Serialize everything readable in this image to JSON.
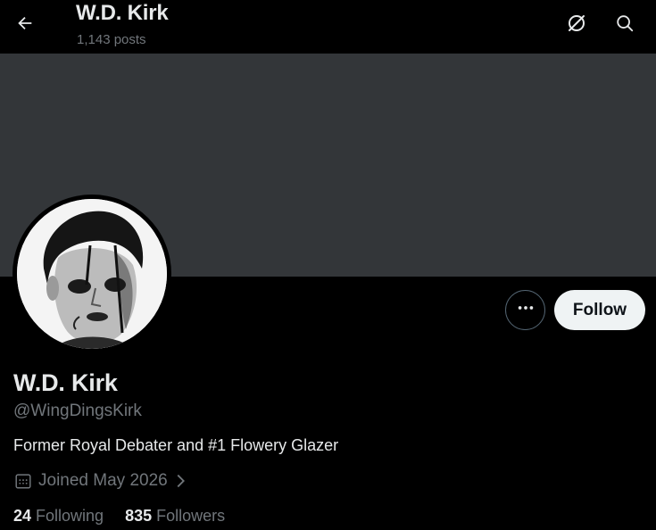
{
  "header": {
    "title": "W.D. Kirk",
    "posts_count": "1,143 posts"
  },
  "profile": {
    "display_name": "W.D. Kirk",
    "handle": "@WingDingsKirk",
    "bio": "Former Royal Debater and #1 Flowery Glazer",
    "joined": "Joined May 2026",
    "following_count": "24",
    "following_label": "Following",
    "followers_count": "835",
    "followers_label": "Followers"
  },
  "actions": {
    "follow_label": "Follow"
  },
  "icons": {
    "back": "arrow-left-icon",
    "grok": "grok-icon",
    "search": "search-icon",
    "more": "more-dots-icon",
    "calendar": "calendar-icon",
    "chevron": "chevron-right-icon"
  },
  "colors": {
    "background": "#000000",
    "banner": "#333639",
    "text_primary": "#e7e9ea",
    "text_secondary": "#71767b",
    "follow_bg": "#eff3f4"
  }
}
